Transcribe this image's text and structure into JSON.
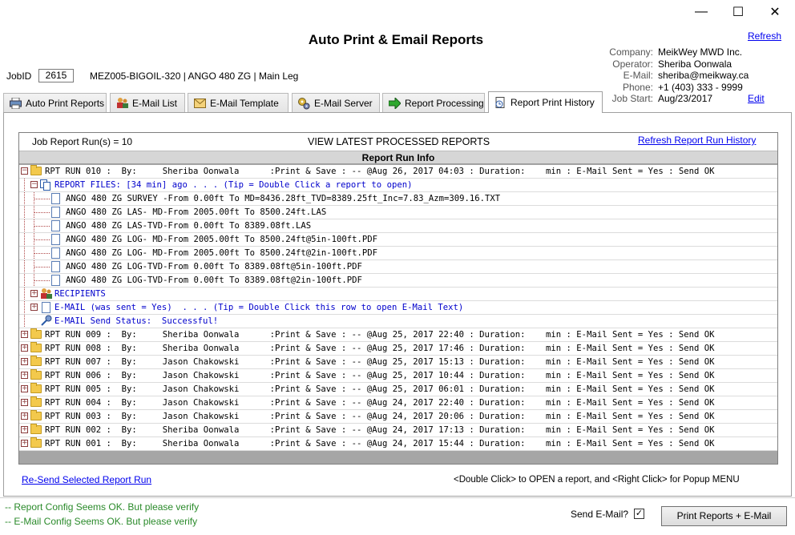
{
  "window": {
    "minimize_glyph": "—",
    "maximize_glyph": "☐",
    "close_glyph": "✕"
  },
  "header": {
    "title": "Auto Print & Email Reports",
    "refresh_link": "Refresh",
    "job_label": "JobID",
    "job_id": "2615",
    "job_desc": "MEZ005-BIGOIL-320 | ANGO 480 ZG | Main Leg"
  },
  "company_info": {
    "company_label": "Company:",
    "company": "MeikWey MWD Inc.",
    "operator_label": "Operator:",
    "operator": "Sheriba Oonwala",
    "email_label": "E-Mail:",
    "email": "sheriba@meikway.ca",
    "phone_label": "Phone:",
    "phone": "+1 (403) 333 - 9999",
    "jobstart_label": "Job Start:",
    "jobstart": "Aug/23/2017",
    "edit_link": "Edit"
  },
  "tabs": [
    {
      "label": "Auto Print Reports",
      "icon": "printer-icon"
    },
    {
      "label": "E-Mail List",
      "icon": "people-icon"
    },
    {
      "label": "E-Mail Template",
      "icon": "envelope-icon"
    },
    {
      "label": "E-Mail Server",
      "icon": "gears-icon"
    },
    {
      "label": "Report Processing",
      "icon": "green-arrow-icon"
    },
    {
      "label": "Report Print History",
      "icon": "history-icon",
      "active": true
    }
  ],
  "grid": {
    "run_count": "Job Report Run(s) = 10",
    "heading": "VIEW LATEST PROCESSED REPORTS",
    "refresh_history_link": "Refresh Report Run History",
    "column_header": "Report Run Info",
    "rows": [
      {
        "kind": "run",
        "expand": "−",
        "text": "RPT RUN 010 :  By:     Sheriba Oonwala      :Print & Save : -- @Aug 26, 2017 04:03 : Duration:    min : E-Mail Sent = Yes : Send OK"
      },
      {
        "kind": "files",
        "expand": "−",
        "text": "REPORT FILES: [34 min] ago . . . (Tip = Double Click a report to open)"
      },
      {
        "kind": "file",
        "text": "ANGO 480 ZG SURVEY -From 0.00ft To MD=8436.28ft_TVD=8389.25ft_Inc=7.83_Azm=309.16.TXT"
      },
      {
        "kind": "file",
        "text": "ANGO 480 ZG LAS- MD-From 2005.00ft To 8500.24ft.LAS"
      },
      {
        "kind": "file",
        "text": "ANGO 480 ZG LAS-TVD-From 0.00ft To 8389.08ft.LAS"
      },
      {
        "kind": "file",
        "text": "ANGO 480 ZG LOG- MD-From 2005.00ft To 8500.24ft@5in-100ft.PDF"
      },
      {
        "kind": "file",
        "text": "ANGO 480 ZG LOG- MD-From 2005.00ft To 8500.24ft@2in-100ft.PDF"
      },
      {
        "kind": "file",
        "text": "ANGO 480 ZG LOG-TVD-From 0.00ft To 8389.08ft@5in-100ft.PDF"
      },
      {
        "kind": "file",
        "text": "ANGO 480 ZG LOG-TVD-From 0.00ft To 8389.08ft@2in-100ft.PDF"
      },
      {
        "kind": "recipients",
        "expand": "+",
        "text": "RECIPIENTS"
      },
      {
        "kind": "email",
        "expand": "+",
        "text": "E-MAIL (was sent = Yes)  . . . (Tip = Double Click this row to open E-Mail Text)"
      },
      {
        "kind": "status",
        "text": "E-MAIL Send Status:  Successful!"
      },
      {
        "kind": "run",
        "expand": "+",
        "text": "RPT RUN 009 :  By:     Sheriba Oonwala      :Print & Save : -- @Aug 25, 2017 22:40 : Duration:    min : E-Mail Sent = Yes : Send OK"
      },
      {
        "kind": "run",
        "expand": "+",
        "text": "RPT RUN 008 :  By:     Sheriba Oonwala      :Print & Save : -- @Aug 25, 2017 17:46 : Duration:    min : E-Mail Sent = Yes : Send OK"
      },
      {
        "kind": "run",
        "expand": "+",
        "text": "RPT RUN 007 :  By:     Jason Chakowski      :Print & Save : -- @Aug 25, 2017 15:13 : Duration:    min : E-Mail Sent = Yes : Send OK"
      },
      {
        "kind": "run",
        "expand": "+",
        "text": "RPT RUN 006 :  By:     Jason Chakowski      :Print & Save : -- @Aug 25, 2017 10:44 : Duration:    min : E-Mail Sent = Yes : Send OK"
      },
      {
        "kind": "run",
        "expand": "+",
        "text": "RPT RUN 005 :  By:     Jason Chakowski      :Print & Save : -- @Aug 25, 2017 06:01 : Duration:    min : E-Mail Sent = Yes : Send OK"
      },
      {
        "kind": "run",
        "expand": "+",
        "text": "RPT RUN 004 :  By:     Jason Chakowski      :Print & Save : -- @Aug 24, 2017 22:40 : Duration:    min : E-Mail Sent = Yes : Send OK"
      },
      {
        "kind": "run",
        "expand": "+",
        "text": "RPT RUN 003 :  By:     Jason Chakowski      :Print & Save : -- @Aug 24, 2017 20:06 : Duration:    min : E-Mail Sent = Yes : Send OK"
      },
      {
        "kind": "run",
        "expand": "+",
        "text": "RPT RUN 002 :  By:     Sheriba Oonwala      :Print & Save : -- @Aug 24, 2017 17:13 : Duration:    min : E-Mail Sent = Yes : Send OK"
      },
      {
        "kind": "run",
        "expand": "+",
        "text": "RPT RUN 001 :  By:     Sheriba Oonwala      :Print & Save : -- @Aug 24, 2017 15:44 : Duration:    min : E-Mail Sent = Yes : Send OK"
      }
    ]
  },
  "footer": {
    "resend_link": "Re-Send Selected Report Run",
    "hint": "<Double Click> to OPEN a report, and <Right Click> for Popup MENU",
    "status1": "-- Report Config Seems OK. But please verify",
    "status2": "-- E-Mail Config Seems OK. But please verify",
    "send_email_label": "Send E-Mail?",
    "send_email_checked": "✓",
    "print_button": "Print Reports + E-Mail"
  },
  "colors": {
    "link": "#0000ee",
    "status_green": "#2a8a2a",
    "tree_blue": "#0000cc",
    "folder": "#f3c94c"
  }
}
